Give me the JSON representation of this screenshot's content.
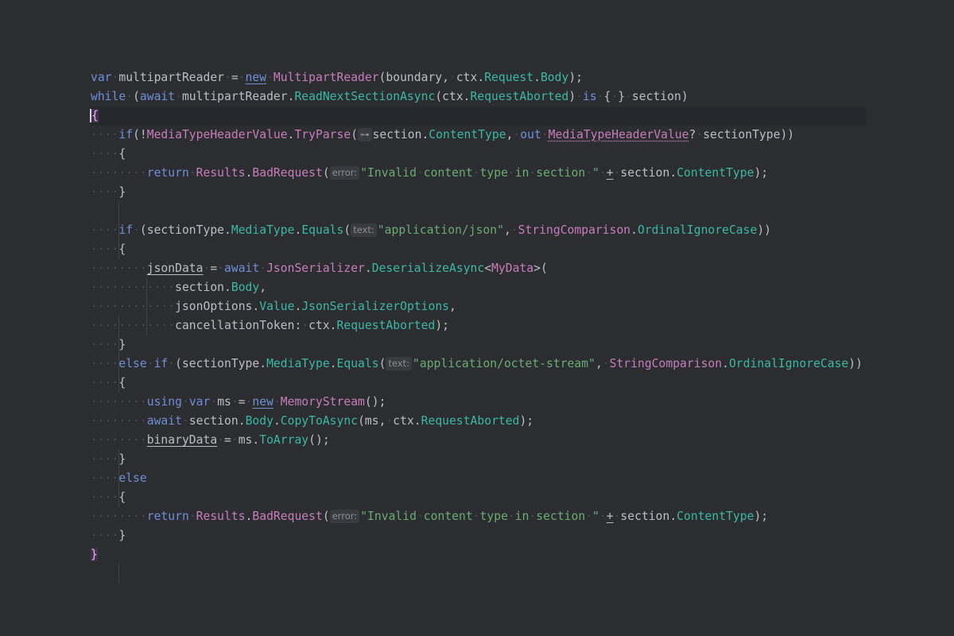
{
  "editor": {
    "colors": {
      "background": "#2b2d30",
      "text": "#bcbec4",
      "keyword": "#6f8fd6",
      "type": "#c77dbb",
      "member": "#3bb8a4",
      "method": "#57aaf7",
      "string": "#6aab73"
    },
    "lines": [
      [
        [
          "var",
          "kw"
        ],
        [
          "·",
          "ws"
        ],
        [
          "multipartReader",
          "t"
        ],
        [
          "·",
          "ws"
        ],
        [
          "=",
          "t"
        ],
        [
          "·",
          "ws"
        ],
        [
          "new",
          "kwu"
        ],
        [
          "·",
          "ws"
        ],
        [
          "MultipartReader",
          "cls"
        ],
        [
          "(boundary,",
          "t"
        ],
        [
          "·",
          "ws"
        ],
        [
          "ctx.",
          "t"
        ],
        [
          "Request",
          "teal"
        ],
        [
          ".",
          "t"
        ],
        [
          "Body",
          "teal"
        ],
        [
          ");",
          "t"
        ]
      ],
      [
        [
          "while",
          "kw"
        ],
        [
          "·",
          "ws"
        ],
        [
          "(",
          "t"
        ],
        [
          "await",
          "kw"
        ],
        [
          "·",
          "ws"
        ],
        [
          "multipartReader.",
          "t"
        ],
        [
          "ReadNextSectionAsync",
          "teal"
        ],
        [
          "(ctx.",
          "t"
        ],
        [
          "RequestAborted",
          "teal"
        ],
        [
          ")",
          "t"
        ],
        [
          "·",
          "ws"
        ],
        [
          "is",
          "kw"
        ],
        [
          "·",
          "ws"
        ],
        [
          "{",
          "t"
        ],
        [
          "·",
          "ws"
        ],
        [
          "}",
          "t"
        ],
        [
          "·",
          "ws"
        ],
        [
          "section)",
          "t"
        ]
      ],
      [
        [
          "{",
          "brace"
        ]
      ],
      [
        [
          "····",
          "ws"
        ],
        [
          "if",
          "kw"
        ],
        [
          "(!",
          "t"
        ],
        [
          "MediaTypeHeaderValue",
          "cls"
        ],
        [
          ".",
          "t"
        ],
        [
          "TryParse",
          "purple"
        ],
        [
          "(",
          "t"
        ],
        [
          "⊶",
          "hint"
        ],
        [
          "section.",
          "t"
        ],
        [
          "ContentType",
          "teal"
        ],
        [
          ",",
          "t"
        ],
        [
          "·",
          "ws"
        ],
        [
          "out",
          "kw"
        ],
        [
          "·",
          "ws"
        ],
        [
          "MediaTypeHeaderValue",
          "dottedcls"
        ],
        [
          "?",
          "t"
        ],
        [
          "·",
          "ws"
        ],
        [
          "sectionType))",
          "t"
        ]
      ],
      [
        [
          "····",
          "ws"
        ],
        [
          "{",
          "t"
        ]
      ],
      [
        [
          "········",
          "ws"
        ],
        [
          "return",
          "kw"
        ],
        [
          "·",
          "ws"
        ],
        [
          "Results",
          "cls"
        ],
        [
          ".",
          "t"
        ],
        [
          "BadRequest",
          "purple"
        ],
        [
          "(",
          "t"
        ],
        [
          "error:",
          "hint"
        ],
        [
          "\"Invalid",
          "str"
        ],
        [
          "·",
          "ws"
        ],
        [
          "content",
          "str"
        ],
        [
          "·",
          "ws"
        ],
        [
          "type",
          "str"
        ],
        [
          "·",
          "ws"
        ],
        [
          "in",
          "str"
        ],
        [
          "·",
          "ws"
        ],
        [
          "section",
          "str"
        ],
        [
          "·",
          "ws"
        ],
        [
          "\"",
          "str"
        ],
        [
          "·",
          "ws"
        ],
        [
          "+",
          "ul"
        ],
        [
          "·",
          "ws"
        ],
        [
          "section.",
          "t"
        ],
        [
          "ContentType",
          "teal"
        ],
        [
          ");",
          "t"
        ]
      ],
      [
        [
          "····",
          "ws"
        ],
        [
          "}",
          "t"
        ]
      ],
      [],
      [
        [
          "····",
          "ws"
        ],
        [
          "if",
          "kw"
        ],
        [
          "·",
          "ws"
        ],
        [
          "(sectionType.",
          "t"
        ],
        [
          "MediaType",
          "teal"
        ],
        [
          ".",
          "t"
        ],
        [
          "Equals",
          "teal"
        ],
        [
          "(",
          "t"
        ],
        [
          "text:",
          "hint"
        ],
        [
          "\"application/json\"",
          "str"
        ],
        [
          ",",
          "t"
        ],
        [
          "·",
          "ws"
        ],
        [
          "StringComparison",
          "cls"
        ],
        [
          ".",
          "t"
        ],
        [
          "OrdinalIgnoreCase",
          "teal"
        ],
        [
          "))",
          "t"
        ]
      ],
      [
        [
          "····",
          "ws"
        ],
        [
          "{",
          "t"
        ]
      ],
      [
        [
          "········",
          "ws"
        ],
        [
          "jsonData",
          "ul"
        ],
        [
          "·",
          "ws"
        ],
        [
          "=",
          "t"
        ],
        [
          "·",
          "ws"
        ],
        [
          "await",
          "kw"
        ],
        [
          "·",
          "ws"
        ],
        [
          "JsonSerializer",
          "cls"
        ],
        [
          ".",
          "t"
        ],
        [
          "DeserializeAsync",
          "teal"
        ],
        [
          "<",
          "t"
        ],
        [
          "MyData",
          "cls"
        ],
        [
          ">(",
          "t"
        ]
      ],
      [
        [
          "············",
          "ws"
        ],
        [
          "section.",
          "t"
        ],
        [
          "Body",
          "teal"
        ],
        [
          ",",
          "t"
        ]
      ],
      [
        [
          "············",
          "ws"
        ],
        [
          "jsonOptions.",
          "t"
        ],
        [
          "Value",
          "teal"
        ],
        [
          ".",
          "t"
        ],
        [
          "JsonSerializerOptions",
          "teal"
        ],
        [
          ",",
          "t"
        ]
      ],
      [
        [
          "············",
          "ws"
        ],
        [
          "cancellationToken:",
          "t"
        ],
        [
          "·",
          "ws"
        ],
        [
          "ctx.",
          "t"
        ],
        [
          "RequestAborted",
          "teal"
        ],
        [
          ");",
          "t"
        ]
      ],
      [
        [
          "····",
          "ws"
        ],
        [
          "}",
          "t"
        ]
      ],
      [
        [
          "····",
          "ws"
        ],
        [
          "else",
          "kw"
        ],
        [
          "·",
          "ws"
        ],
        [
          "if",
          "kw"
        ],
        [
          "·",
          "ws"
        ],
        [
          "(sectionType.",
          "t"
        ],
        [
          "MediaType",
          "teal"
        ],
        [
          ".",
          "t"
        ],
        [
          "Equals",
          "teal"
        ],
        [
          "(",
          "t"
        ],
        [
          "text:",
          "hint"
        ],
        [
          "\"application/octet-stream\"",
          "str"
        ],
        [
          ",",
          "t"
        ],
        [
          "·",
          "ws"
        ],
        [
          "StringComparison",
          "cls"
        ],
        [
          ".",
          "t"
        ],
        [
          "OrdinalIgnoreCase",
          "teal"
        ],
        [
          "))",
          "t"
        ]
      ],
      [
        [
          "····",
          "ws"
        ],
        [
          "{",
          "t"
        ]
      ],
      [
        [
          "········",
          "ws"
        ],
        [
          "using",
          "kw"
        ],
        [
          "·",
          "ws"
        ],
        [
          "var",
          "kw"
        ],
        [
          "·",
          "ws"
        ],
        [
          "ms",
          "t"
        ],
        [
          "·",
          "ws"
        ],
        [
          "=",
          "t"
        ],
        [
          "·",
          "ws"
        ],
        [
          "new",
          "kwu"
        ],
        [
          "·",
          "ws"
        ],
        [
          "MemoryStream",
          "cls"
        ],
        [
          "();",
          "t"
        ]
      ],
      [
        [
          "········",
          "ws"
        ],
        [
          "await",
          "kw"
        ],
        [
          "·",
          "ws"
        ],
        [
          "section.",
          "t"
        ],
        [
          "Body",
          "teal"
        ],
        [
          ".",
          "t"
        ],
        [
          "CopyToAsync",
          "teal"
        ],
        [
          "(ms,",
          "t"
        ],
        [
          "·",
          "ws"
        ],
        [
          "ctx.",
          "t"
        ],
        [
          "RequestAborted",
          "teal"
        ],
        [
          ");",
          "t"
        ]
      ],
      [
        [
          "········",
          "ws"
        ],
        [
          "binaryData",
          "ul"
        ],
        [
          "·",
          "ws"
        ],
        [
          "=",
          "t"
        ],
        [
          "·",
          "ws"
        ],
        [
          "ms.",
          "t"
        ],
        [
          "ToArray",
          "teal"
        ],
        [
          "();",
          "t"
        ]
      ],
      [
        [
          "····",
          "ws"
        ],
        [
          "}",
          "t"
        ]
      ],
      [
        [
          "····",
          "ws"
        ],
        [
          "else",
          "kw"
        ]
      ],
      [
        [
          "····",
          "ws"
        ],
        [
          "{",
          "t"
        ]
      ],
      [
        [
          "········",
          "ws"
        ],
        [
          "return",
          "kw"
        ],
        [
          "·",
          "ws"
        ],
        [
          "Results",
          "cls"
        ],
        [
          ".",
          "t"
        ],
        [
          "BadRequest",
          "purple"
        ],
        [
          "(",
          "t"
        ],
        [
          "error:",
          "hint"
        ],
        [
          "\"Invalid",
          "str"
        ],
        [
          "·",
          "ws"
        ],
        [
          "content",
          "str"
        ],
        [
          "·",
          "ws"
        ],
        [
          "type",
          "str"
        ],
        [
          "·",
          "ws"
        ],
        [
          "in",
          "str"
        ],
        [
          "·",
          "ws"
        ],
        [
          "section",
          "str"
        ],
        [
          "·",
          "ws"
        ],
        [
          "\"",
          "str"
        ],
        [
          "·",
          "ws"
        ],
        [
          "+",
          "ul"
        ],
        [
          "·",
          "ws"
        ],
        [
          "section.",
          "t"
        ],
        [
          "ContentType",
          "teal"
        ],
        [
          ");",
          "t"
        ]
      ],
      [
        [
          "····",
          "ws"
        ],
        [
          "}",
          "t"
        ]
      ],
      [
        [
          "}",
          "brace"
        ]
      ]
    ]
  }
}
